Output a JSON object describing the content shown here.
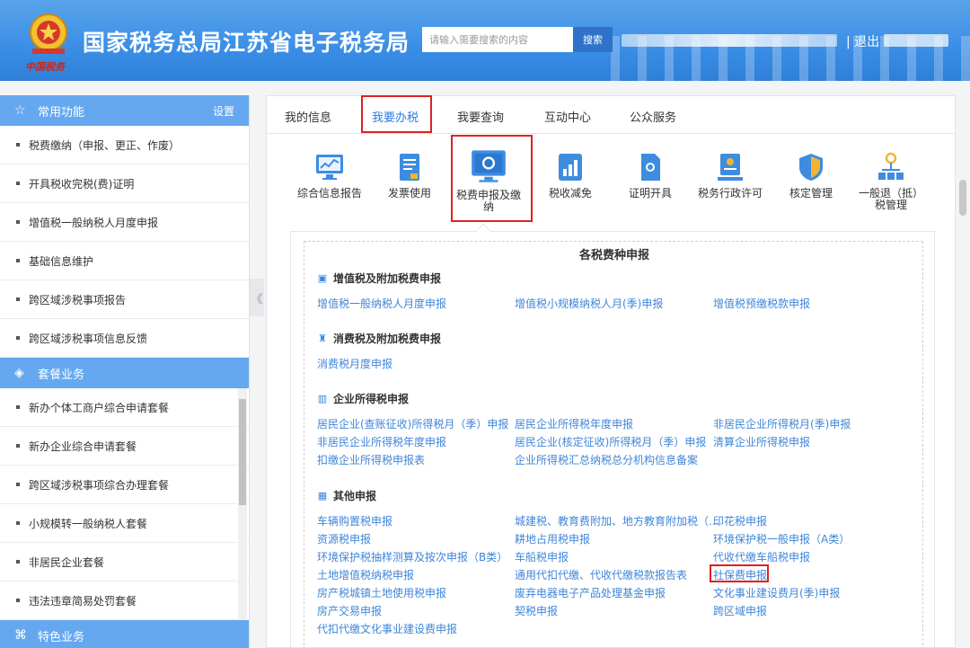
{
  "header": {
    "title": "国家税务总局江苏省电子税务局",
    "emblem_text": "中国税务",
    "search_placeholder": "请输入需要搜索的内容",
    "search_button": "搜索",
    "logout": "| 退出",
    "bg_color": "#3a8ee6"
  },
  "sidebar": {
    "common": {
      "title": "常用功能",
      "setting": "设置",
      "items": [
        "税费缴纳（申报、更正、作废）",
        "开具税收完税(费)证明",
        "增值税一般纳税人月度申报",
        "基础信息维护",
        "跨区域涉税事项报告",
        "跨区域涉税事项信息反馈"
      ]
    },
    "package": {
      "title": "套餐业务",
      "items": [
        "新办个体工商户综合申请套餐",
        "新办企业综合申请套餐",
        "跨区域涉税事项综合办理套餐",
        "小规模转一般纳税人套餐",
        "非居民企业套餐",
        "违法违章简易处罚套餐"
      ]
    },
    "special": {
      "title": "特色业务"
    },
    "collapse_glyph": "《",
    "head_color": "#65a8ef"
  },
  "tabs": [
    "我的信息",
    "我要办税",
    "我要查询",
    "互动中心",
    "公众服务"
  ],
  "functions": [
    "综合信息报告",
    "发票使用",
    "税费申报及缴纳",
    "税收减免",
    "证明开具",
    "税务行政许可",
    "核定管理",
    "一般退（抵）税管理"
  ],
  "content": {
    "title": "各税费种申报",
    "sections": [
      {
        "title": "增值税及附加税费申报",
        "links": [
          "增值税一般纳税人月度申报",
          "增值税小规模纳税人月(季)申报",
          "增值税预缴税款申报"
        ]
      },
      {
        "title": "消费税及附加税费申报",
        "links": [
          "消费税月度申报"
        ]
      },
      {
        "title": "企业所得税申报",
        "links": [
          "居民企业(查账征收)所得税月（季）申报",
          "居民企业所得税年度申报",
          "非居民企业所得税月(季)申报",
          "非居民企业所得税年度申报",
          "居民企业(核定征收)所得税月（季）申报",
          "清算企业所得税申报",
          "扣缴企业所得税申报表",
          "企业所得税汇总纳税总分机构信息备案"
        ]
      },
      {
        "title": "其他申报",
        "links": [
          "车辆购置税申报",
          "城建税、教育费附加、地方教育附加税（…",
          "印花税申报",
          "资源税申报",
          "耕地占用税申报",
          "环境保护税一般申报（A类）",
          "环境保护税抽样测算及按次申报（B类）",
          "车船税申报",
          "代收代缴车船税申报",
          "土地增值税纳税申报",
          "通用代扣代缴、代收代缴税款报告表",
          "社保费申报",
          "房产税城镇土地使用税申报",
          "废弃电器电子产品处理基金申报",
          "文化事业建设费月(季)申报",
          "房产交易申报",
          "契税申报",
          "跨区域申报",
          "代扣代缴文化事业建设费申报"
        ]
      }
    ]
  },
  "colors": {
    "link": "#3f86d9",
    "accent": "#2d7be5",
    "highlight": "#e02020"
  }
}
